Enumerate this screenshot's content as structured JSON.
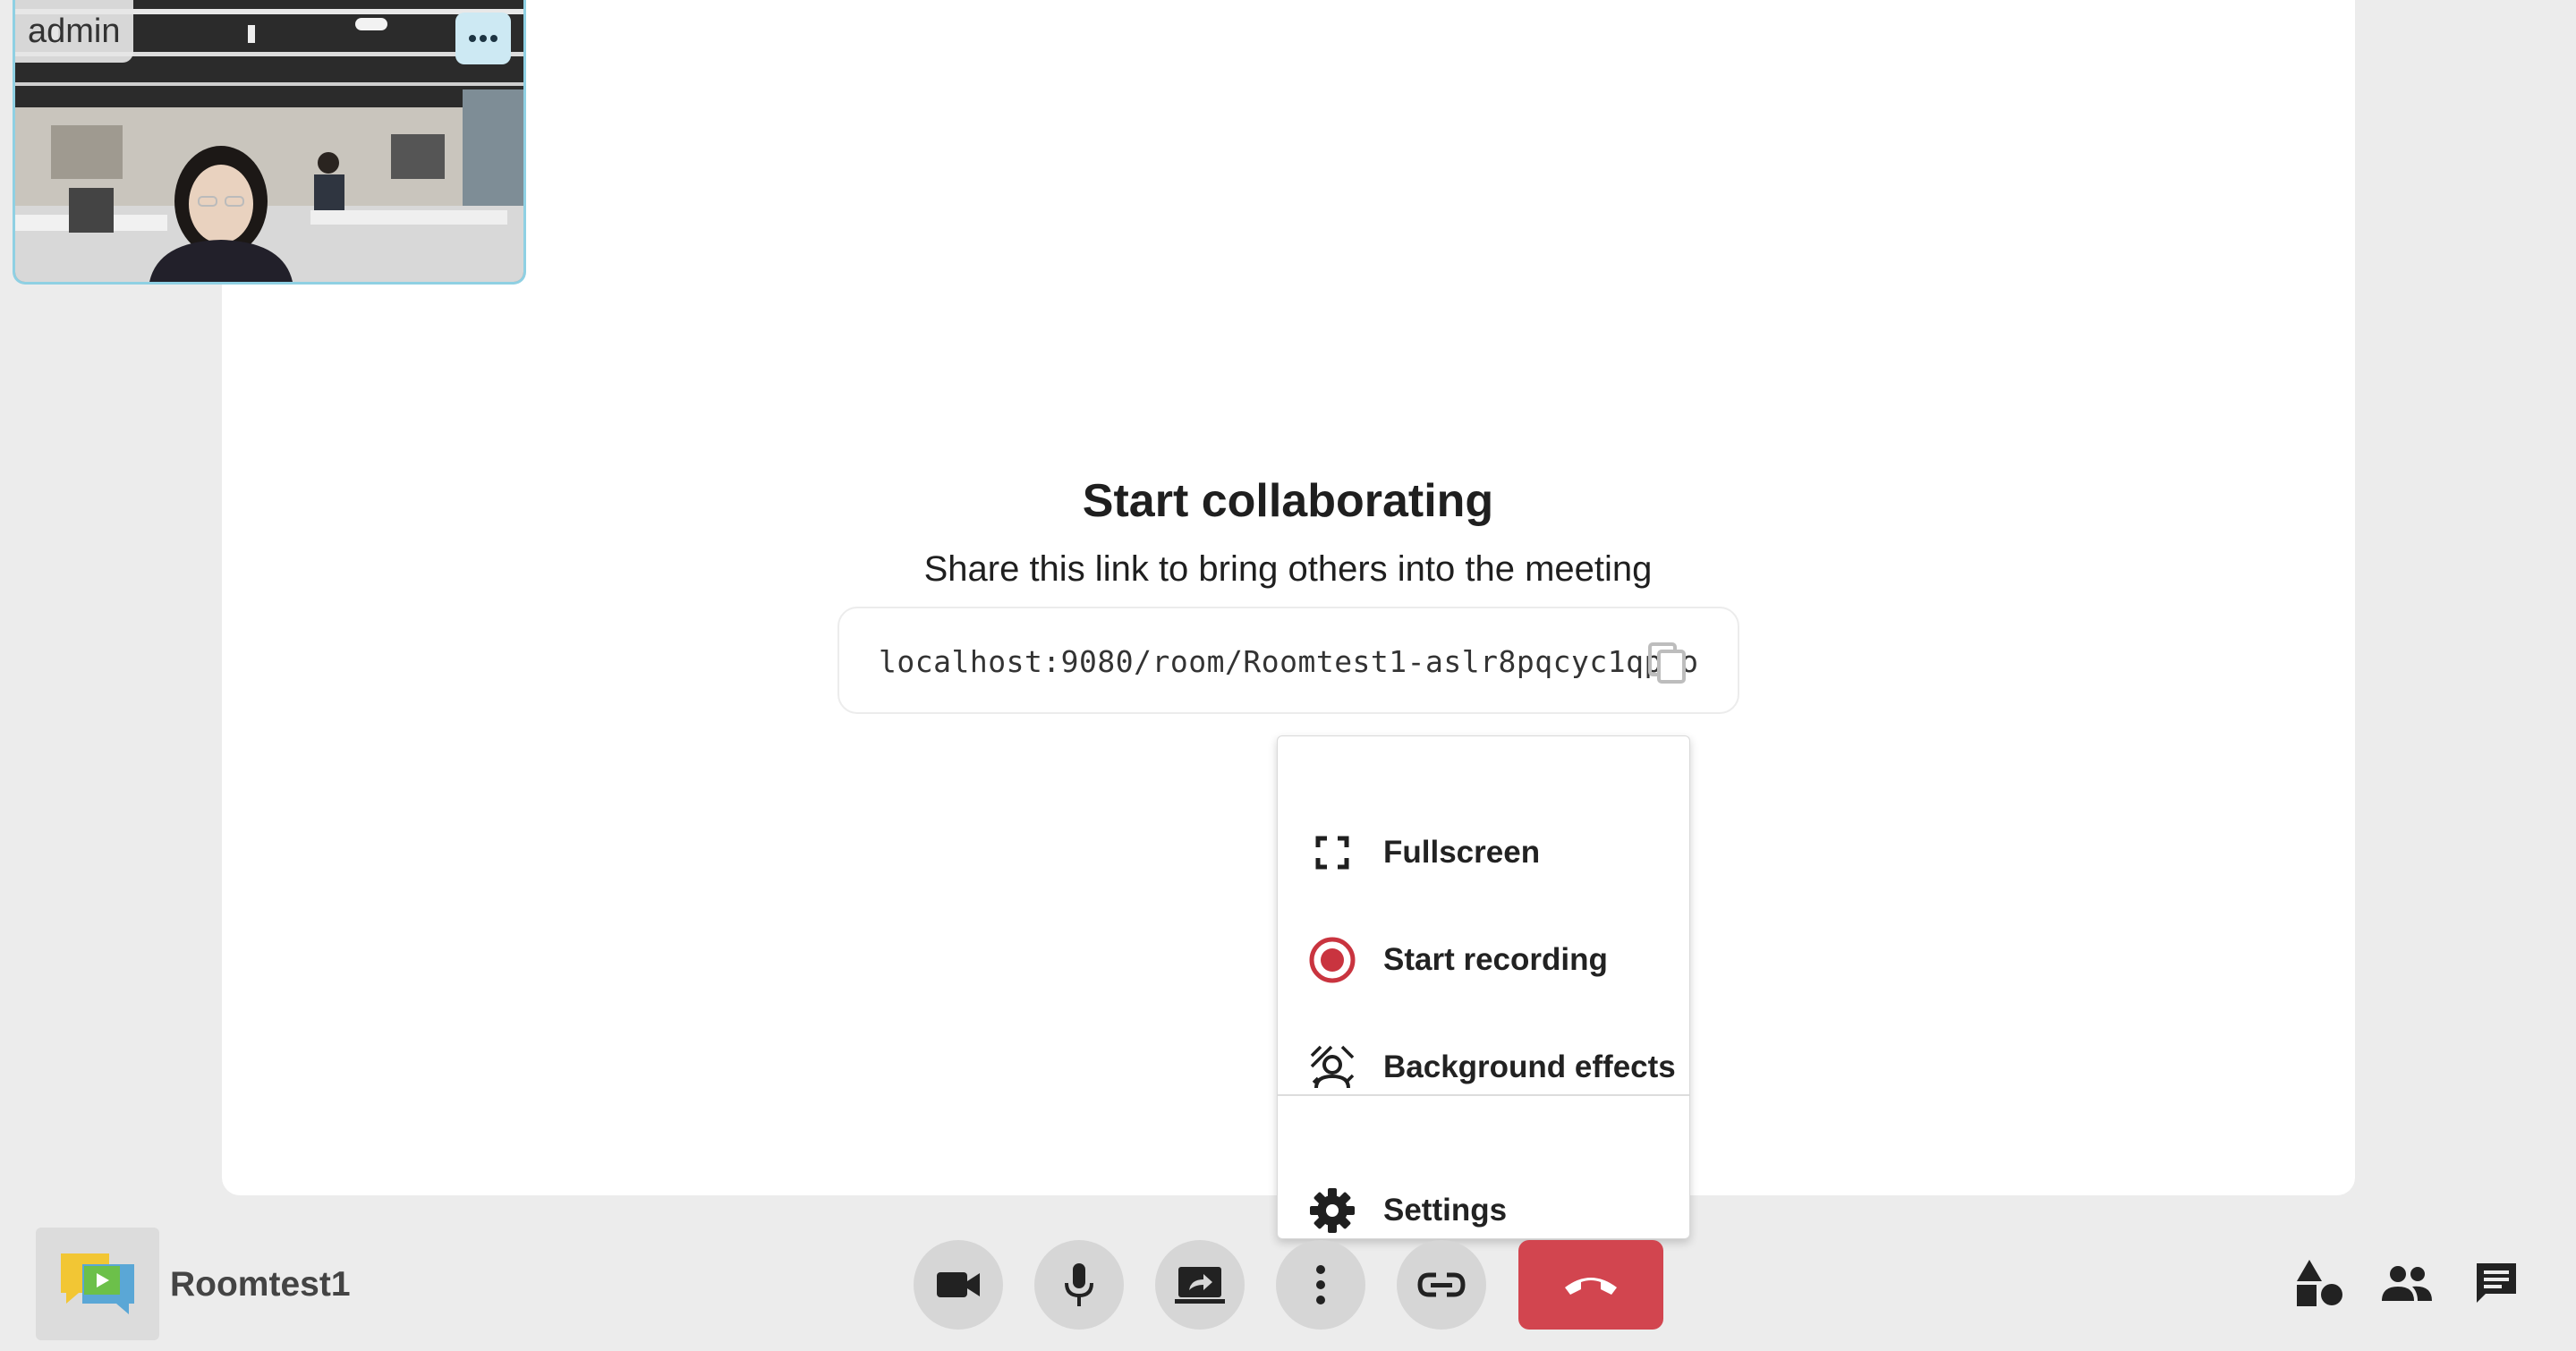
{
  "participant": {
    "name": "admin",
    "menu_icon": "more-horizontal-icon"
  },
  "collab": {
    "title": "Start collaborating",
    "subtitle": "Share this link to bring others into the meeting",
    "link": "localhost:9080/room/Roomtest1-aslr8pqcyc1qpvo",
    "copy_icon": "copy-icon"
  },
  "menu": {
    "items": [
      {
        "label": "Fullscreen",
        "icon": "fullscreen-icon"
      },
      {
        "label": "Start recording",
        "icon": "record-icon"
      },
      {
        "label": "Background effects",
        "icon": "background-effects-icon"
      },
      {
        "label": "Settings",
        "icon": "gear-icon"
      }
    ]
  },
  "toolbar": {
    "room_name": "Roomtest1",
    "buttons": [
      {
        "name": "camera",
        "icon": "video-camera-icon"
      },
      {
        "name": "microphone",
        "icon": "microphone-icon"
      },
      {
        "name": "screen-share",
        "icon": "screen-share-icon"
      },
      {
        "name": "more-options",
        "icon": "more-vertical-icon"
      },
      {
        "name": "copy-link",
        "icon": "link-icon"
      },
      {
        "name": "leave",
        "icon": "hang-up-icon"
      }
    ],
    "side_buttons": [
      {
        "name": "activities",
        "icon": "shapes-icon"
      },
      {
        "name": "participants",
        "icon": "people-icon"
      },
      {
        "name": "chat",
        "icon": "chat-icon"
      }
    ]
  },
  "colors": {
    "record_red": "#c9343f",
    "hangup_red": "#d2454f",
    "tile_border": "#8fd0e3",
    "control_gray": "#d6d6d6"
  }
}
